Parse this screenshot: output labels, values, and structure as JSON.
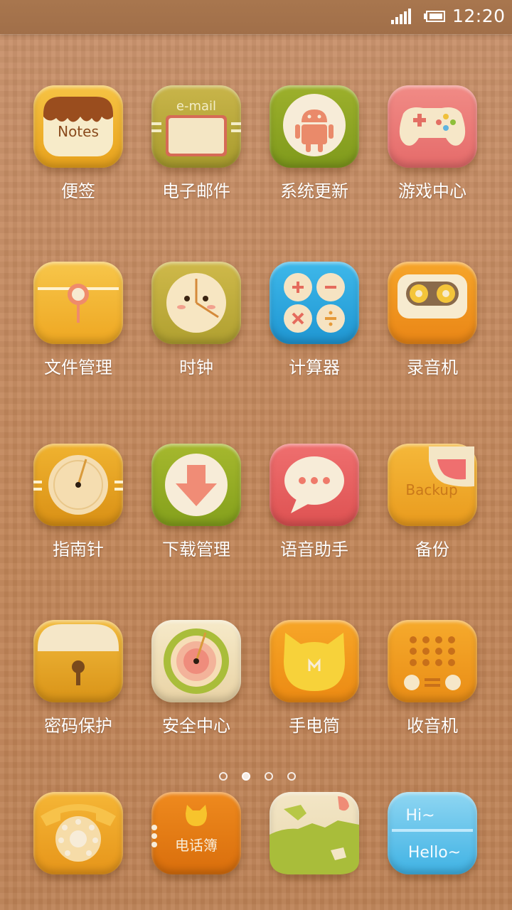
{
  "status_bar": {
    "time": "12:20"
  },
  "apps": [
    {
      "label": "便签",
      "icon": "notes-icon",
      "text": "Notes"
    },
    {
      "label": "电子邮件",
      "icon": "email-icon",
      "text": "e-mail"
    },
    {
      "label": "系统更新",
      "icon": "android-icon"
    },
    {
      "label": "游戏中心",
      "icon": "gamepad-icon"
    },
    {
      "label": "文件管理",
      "icon": "folder-icon"
    },
    {
      "label": "时钟",
      "icon": "clock-icon"
    },
    {
      "label": "计算器",
      "icon": "calculator-icon"
    },
    {
      "label": "录音机",
      "icon": "recorder-icon"
    },
    {
      "label": "指南针",
      "icon": "compass-icon"
    },
    {
      "label": "下载管理",
      "icon": "download-icon"
    },
    {
      "label": "语音助手",
      "icon": "speech-bubble-icon"
    },
    {
      "label": "备份",
      "icon": "backup-icon",
      "text": "Backup"
    },
    {
      "label": "密码保护",
      "icon": "lock-icon"
    },
    {
      "label": "安全中心",
      "icon": "radar-icon"
    },
    {
      "label": "手电筒",
      "icon": "flashlight-cat-icon"
    },
    {
      "label": "收音机",
      "icon": "radio-icon"
    }
  ],
  "pager": {
    "count": 4,
    "active_index": 1
  },
  "dock": [
    {
      "icon": "telephone-icon"
    },
    {
      "icon": "contacts-book-icon",
      "text": "电话簿"
    },
    {
      "icon": "globe-icon"
    },
    {
      "icon": "messages-icon",
      "text_top": "Hi~",
      "text_bottom": "Hello~"
    }
  ],
  "colors": {
    "wallpaper": "#c48a5e",
    "status_bar": "#a1704a",
    "label_text": "#ffffff"
  }
}
